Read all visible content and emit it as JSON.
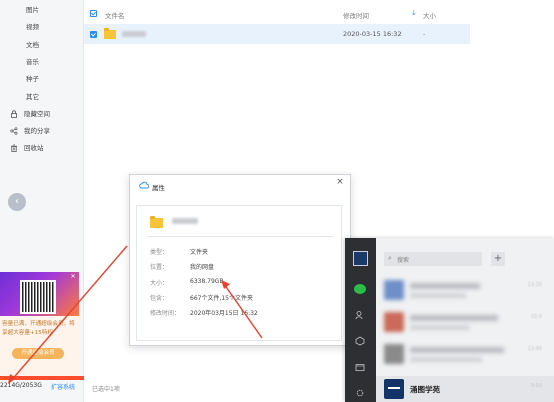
{
  "sidebar": {
    "items": [
      {
        "label": "图片"
      },
      {
        "label": "视频"
      },
      {
        "label": "文档"
      },
      {
        "label": "音乐"
      },
      {
        "label": "种子"
      },
      {
        "label": "其它"
      },
      {
        "label": "隐藏空间",
        "icon": "lock-icon"
      },
      {
        "label": "我的分享",
        "icon": "share-icon"
      },
      {
        "label": "回收站",
        "icon": "trash-icon"
      }
    ],
    "promo": {
      "text": "容量已满，开通超级会员，将享超大容量+15特权",
      "button": "开通超级会员"
    },
    "storage": {
      "usage": "2214G/2053G",
      "expand_link": "扩容系统",
      "used_fraction": 1.0,
      "bar_color": "#ff4d2e"
    }
  },
  "file_list": {
    "columns": {
      "name": "文件名",
      "modified": "修改时间",
      "size": "大小"
    },
    "sort_arrow": "↓",
    "rows": [
      {
        "date": "2020-03-15 16:32",
        "size": "-"
      }
    ],
    "status": "已选中1项"
  },
  "dialog": {
    "title": "属性",
    "close": "×",
    "labels": {
      "type": "类型：",
      "location": "位置：",
      "size": "大小：",
      "contains": "包含：",
      "modified": "修改时间："
    },
    "values": {
      "type": "文件夹",
      "location": "我的网盘",
      "size": "6338.79GB",
      "contains": "667个文件,15个文件夹",
      "modified": "2020年03月15日 16:32"
    }
  },
  "chat": {
    "search_placeholder": "搜索",
    "plus": "+",
    "last_item_name": "涌图学苑",
    "times": [
      "13:10",
      "15:0",
      "11",
      "13:40",
      "9:03"
    ]
  },
  "colors": {
    "accent": "#2f8cf0",
    "annotation": "#e8412c",
    "folder": "#f8c43a"
  }
}
